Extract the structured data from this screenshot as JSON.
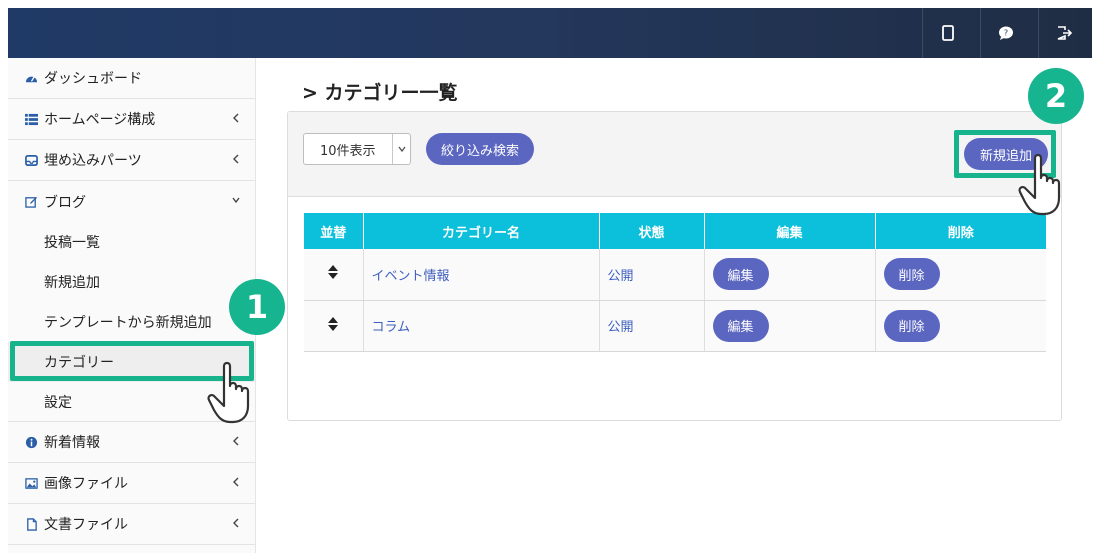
{
  "topbar": {
    "buttons": [
      {
        "icon": "tablet-icon"
      },
      {
        "icon": "chat-icon"
      },
      {
        "icon": "logout-icon"
      }
    ]
  },
  "sidebar": {
    "items": [
      {
        "label": "ダッシュボード",
        "icon": "dashboard-icon",
        "chevron": false
      },
      {
        "label": "ホームページ構成",
        "icon": "list-icon",
        "chevron": "left"
      },
      {
        "label": "埋め込みパーツ",
        "icon": "inbox-icon",
        "chevron": "left"
      },
      {
        "label": "ブログ",
        "icon": "edit-icon",
        "chevron": "down"
      },
      {
        "label": "新着情報",
        "icon": "info-icon",
        "chevron": "left"
      },
      {
        "label": "画像ファイル",
        "icon": "image-icon",
        "chevron": "left"
      },
      {
        "label": "文書ファイル",
        "icon": "file-icon",
        "chevron": "left"
      }
    ],
    "blog_sub": [
      "投稿一覧",
      "新規追加",
      "テンプレートから新規追加",
      "カテゴリー",
      "設定"
    ],
    "active_sub": "カテゴリー"
  },
  "badges": {
    "step1": "1",
    "step2": "2"
  },
  "main": {
    "title": "> カテゴリー一覧",
    "per_page_select": "10件表示",
    "filter_button": "絞り込み検索",
    "add_button": "新規追加",
    "table": {
      "headers": [
        "並替",
        "カテゴリー名",
        "状態",
        "編集",
        "削除"
      ],
      "rows": [
        {
          "name": "イベント情報",
          "status": "公開",
          "edit": "編集",
          "delete": "削除"
        },
        {
          "name": "コラム",
          "status": "公開",
          "edit": "編集",
          "delete": "削除"
        }
      ]
    }
  },
  "colors": {
    "accent": "#5b66c1",
    "header": "#0cc0db",
    "highlight": "#16b38c"
  }
}
